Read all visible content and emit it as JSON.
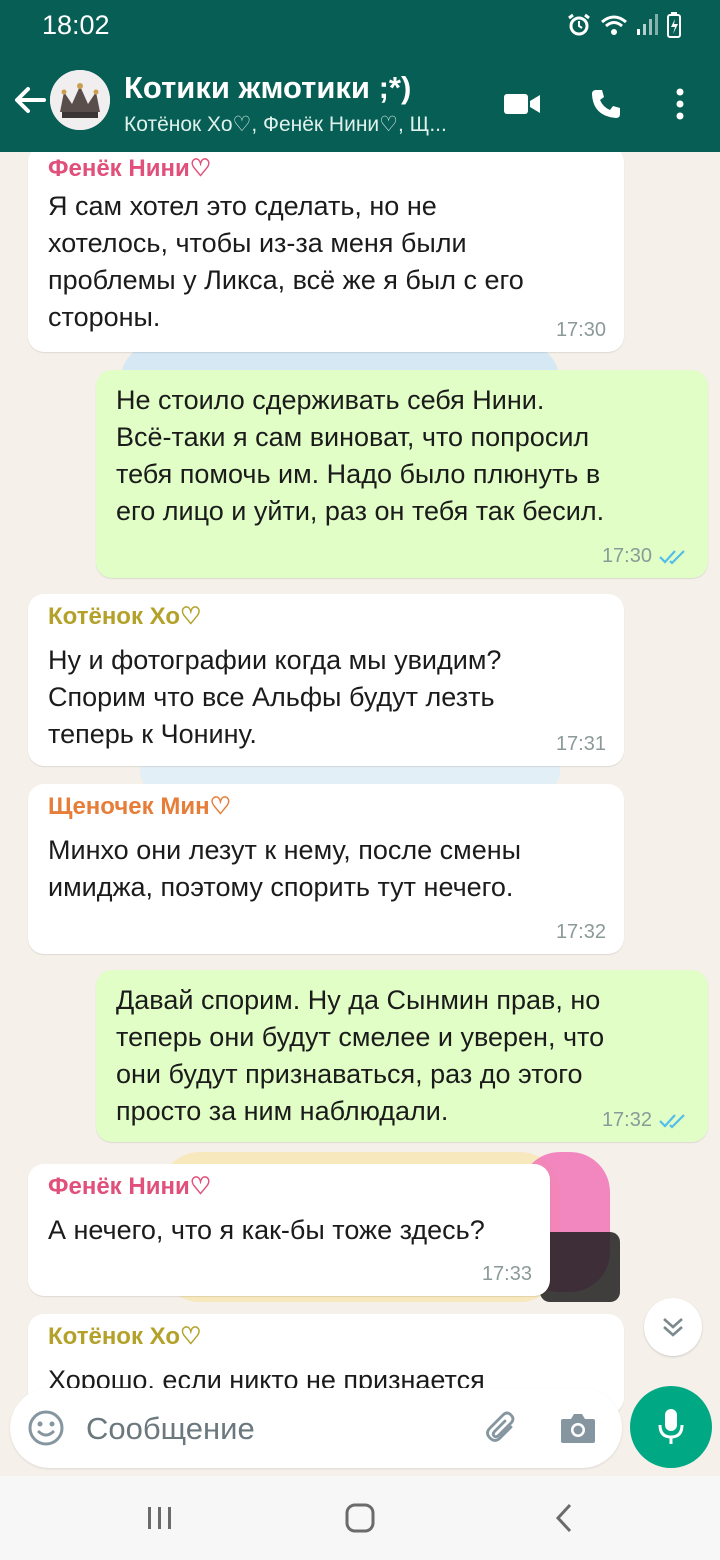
{
  "status_bar": {
    "time": "18:02"
  },
  "header": {
    "title": "Котики жмотики ;*)",
    "subtitle": "Котёнок Хо♡, Фенёк Нини♡, Щ..."
  },
  "colors": {
    "header_bg": "#075e54",
    "outgoing_bubble": "#e1fec6",
    "incoming_bubble": "#ffffff",
    "read_ticks": "#53bdeb",
    "mic_button": "#00a884",
    "sender_fenek": "#e0507a",
    "sender_koten": "#b4a12a",
    "sender_shchenochek": "#e67e3a"
  },
  "messages": [
    {
      "direction": "in",
      "sender": "Фенёк Нини♡",
      "text": "Я сам хотел это сделать, но не\nхотелось, чтобы из-за меня были\nпроблемы у Ликса, всё же я был с его\nстороны.",
      "time": "17:30"
    },
    {
      "direction": "out",
      "text": "Не стоило сдерживать себя Нини.\nВсё-таки  я сам виноват, что попросил\nтебя помочь им. Надо было плюнуть в\nего лицо и уйти, раз он тебя так бесил.",
      "time": "17:30"
    },
    {
      "direction": "in",
      "sender": "Котёнок Хо♡",
      "text": "Ну и фотографии когда мы увидим?\nСпорим что все Альфы будут лезть\nтеперь к Чонину.",
      "time": "17:31"
    },
    {
      "direction": "in",
      "sender": "Щеночек Мин♡",
      "text": "Минхо они лезут к нему, после смены\nимиджа, поэтому спорить тут нечего.",
      "time": "17:32"
    },
    {
      "direction": "out",
      "text": "Давай спорим. Ну да Сынмин прав, но\nтеперь они будут смелее и уверен, что\nони будут признаваться, раз до этого\nпросто за ним наблюдали.",
      "time": "17:32"
    },
    {
      "direction": "in",
      "sender": "Фенёк Нини♡",
      "text": "А нечего, что я как-бы тоже здесь?",
      "time": "17:33"
    },
    {
      "direction": "in",
      "sender": "Котёнок Хо♡",
      "text": "Хорошо, если никто не признается"
    }
  ],
  "composer": {
    "placeholder": "Сообщение"
  }
}
